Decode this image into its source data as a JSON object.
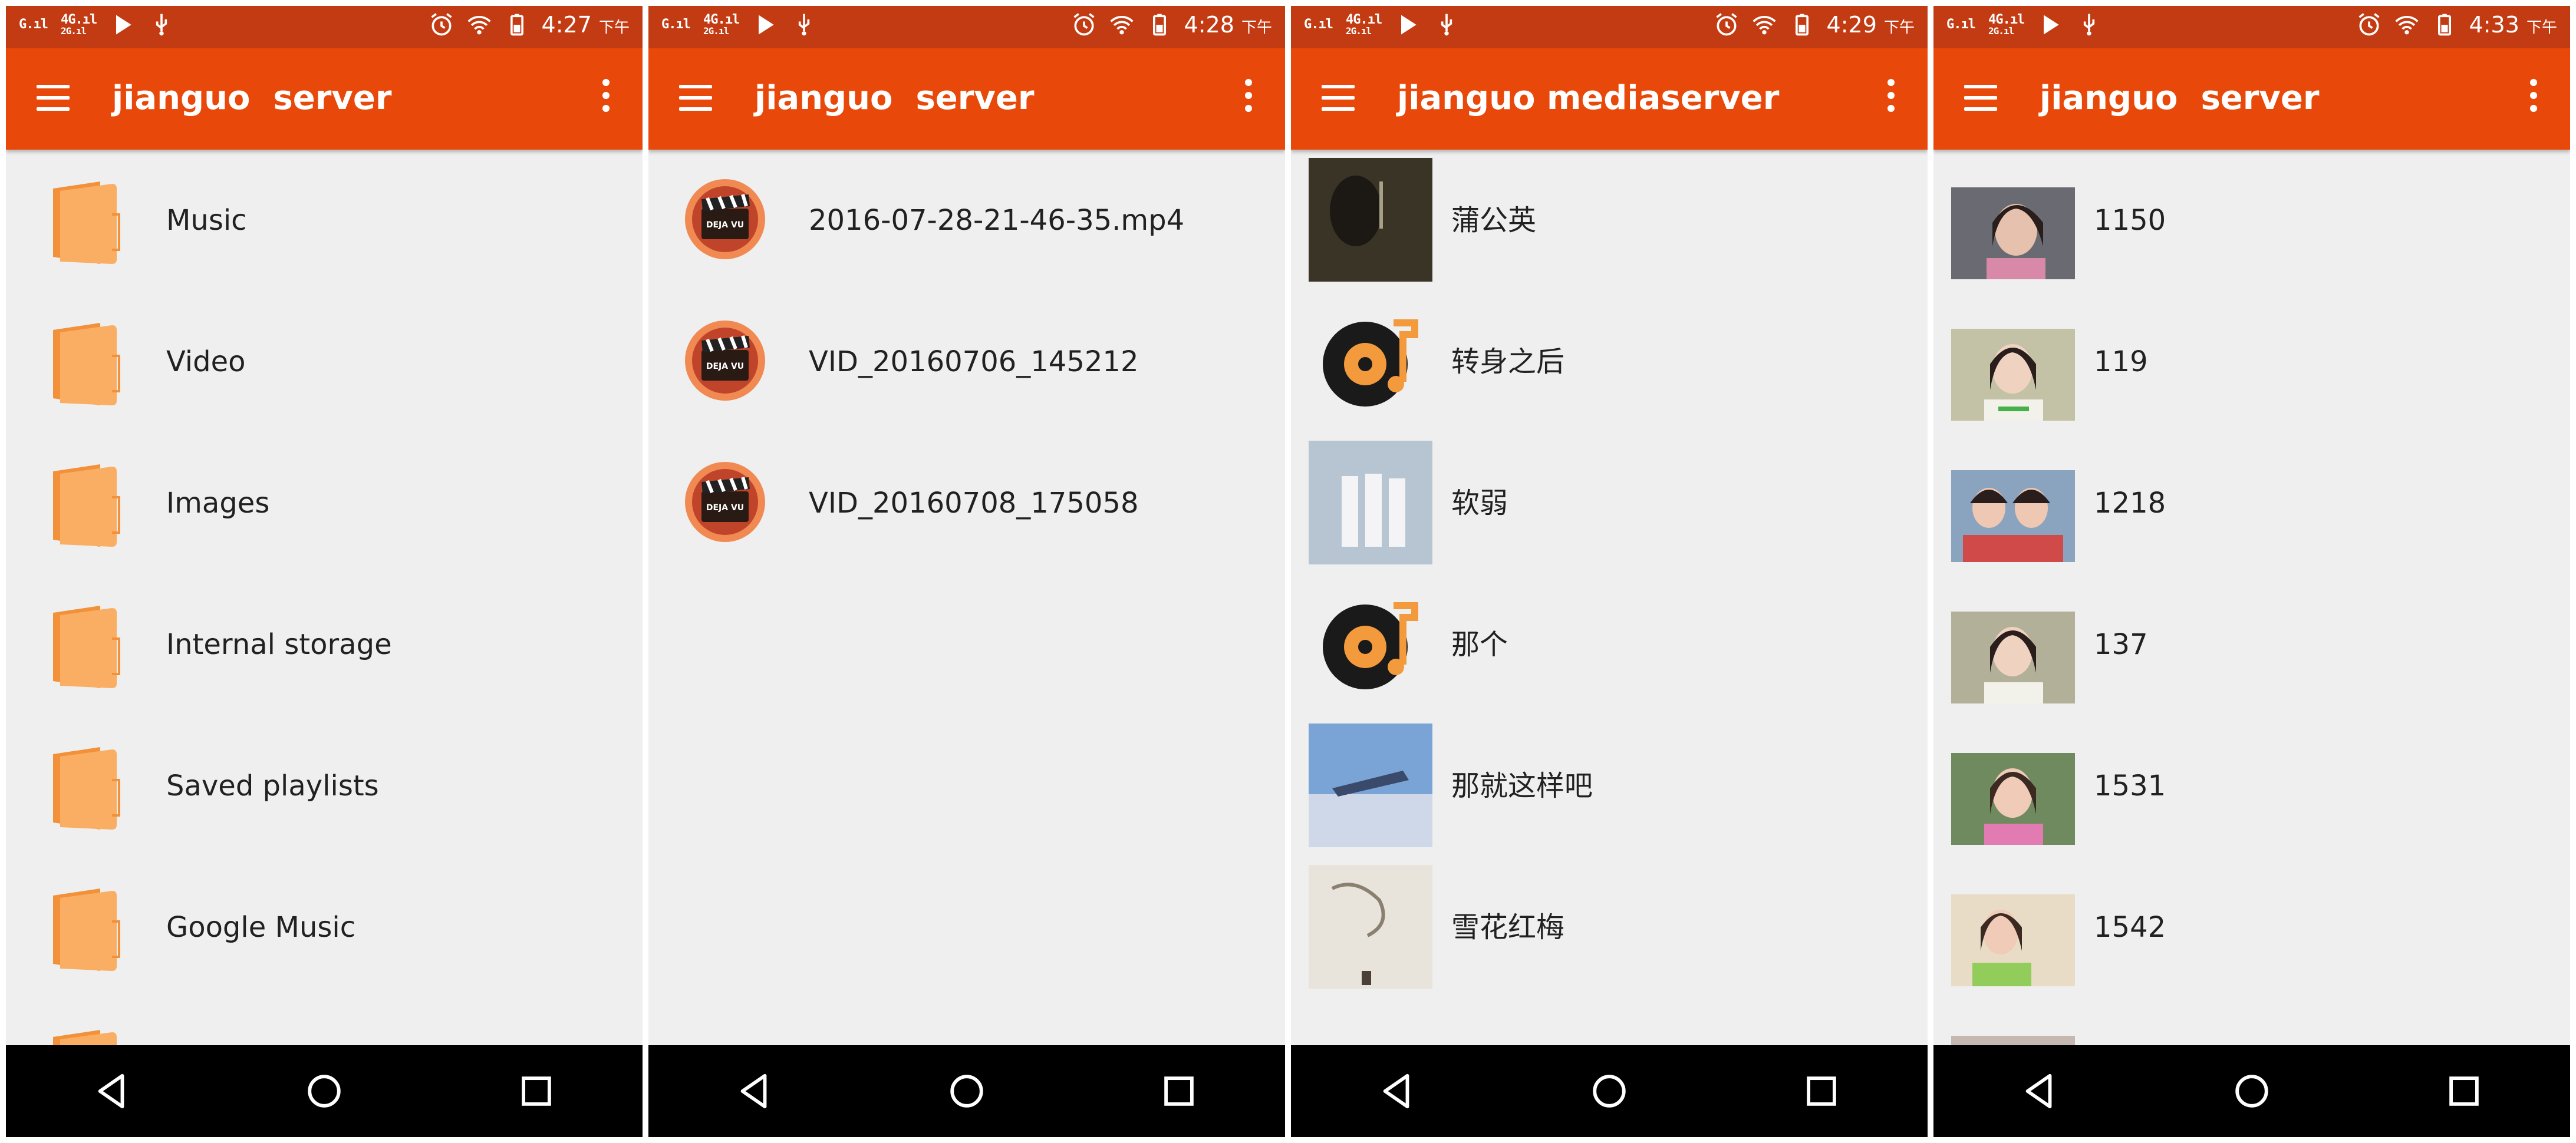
{
  "colors": {
    "statusbar": "#c33b13",
    "appbar": "#e8490a",
    "background": "#efefef",
    "navbar": "#000000",
    "text": "#212121",
    "folder": "#f7a35a"
  },
  "screens": [
    {
      "status": {
        "net1": "G",
        "net2": "4G 2G",
        "time": "4:27",
        "ampm": "下午"
      },
      "title": "jianguo  server",
      "item_icon": "folder-icon",
      "items": [
        {
          "label": "Music"
        },
        {
          "label": "Video"
        },
        {
          "label": "Images"
        },
        {
          "label": "Internal storage"
        },
        {
          "label": "Saved playlists"
        },
        {
          "label": "Google Music"
        }
      ]
    },
    {
      "status": {
        "net1": "G",
        "net2": "4G 2G",
        "time": "4:28",
        "ampm": "下午"
      },
      "title": "jianguo  server",
      "item_icon": "video-clapper-icon",
      "icon_text": "DEJA VU",
      "items": [
        {
          "label": "2016-07-28-21-46-35.mp4"
        },
        {
          "label": "VID_20160706_145212"
        },
        {
          "label": "VID_20160708_175058"
        }
      ]
    },
    {
      "status": {
        "net1": "G",
        "net2": "4G 2G",
        "time": "4:29",
        "ampm": "下午"
      },
      "title": "jianguo mediaserver",
      "items": [
        {
          "label": "蒲公英",
          "icon": "album-cover-thumbnail"
        },
        {
          "label": "转身之后",
          "icon": "music-disc-icon"
        },
        {
          "label": "软弱",
          "icon": "album-cover-thumbnail"
        },
        {
          "label": "那个",
          "icon": "music-disc-icon"
        },
        {
          "label": "那就这样吧",
          "icon": "album-cover-thumbnail"
        },
        {
          "label": "雪花红梅",
          "icon": "album-cover-thumbnail"
        }
      ]
    },
    {
      "status": {
        "net1": "G",
        "net2": "4G 2G",
        "time": "4:33",
        "ampm": "下午"
      },
      "title": "jianguo  server",
      "item_icon": "image-thumbnail",
      "items": [
        {
          "label": "1150"
        },
        {
          "label": "119"
        },
        {
          "label": "1218"
        },
        {
          "label": "137"
        },
        {
          "label": "1531"
        },
        {
          "label": "1542"
        }
      ]
    }
  ]
}
